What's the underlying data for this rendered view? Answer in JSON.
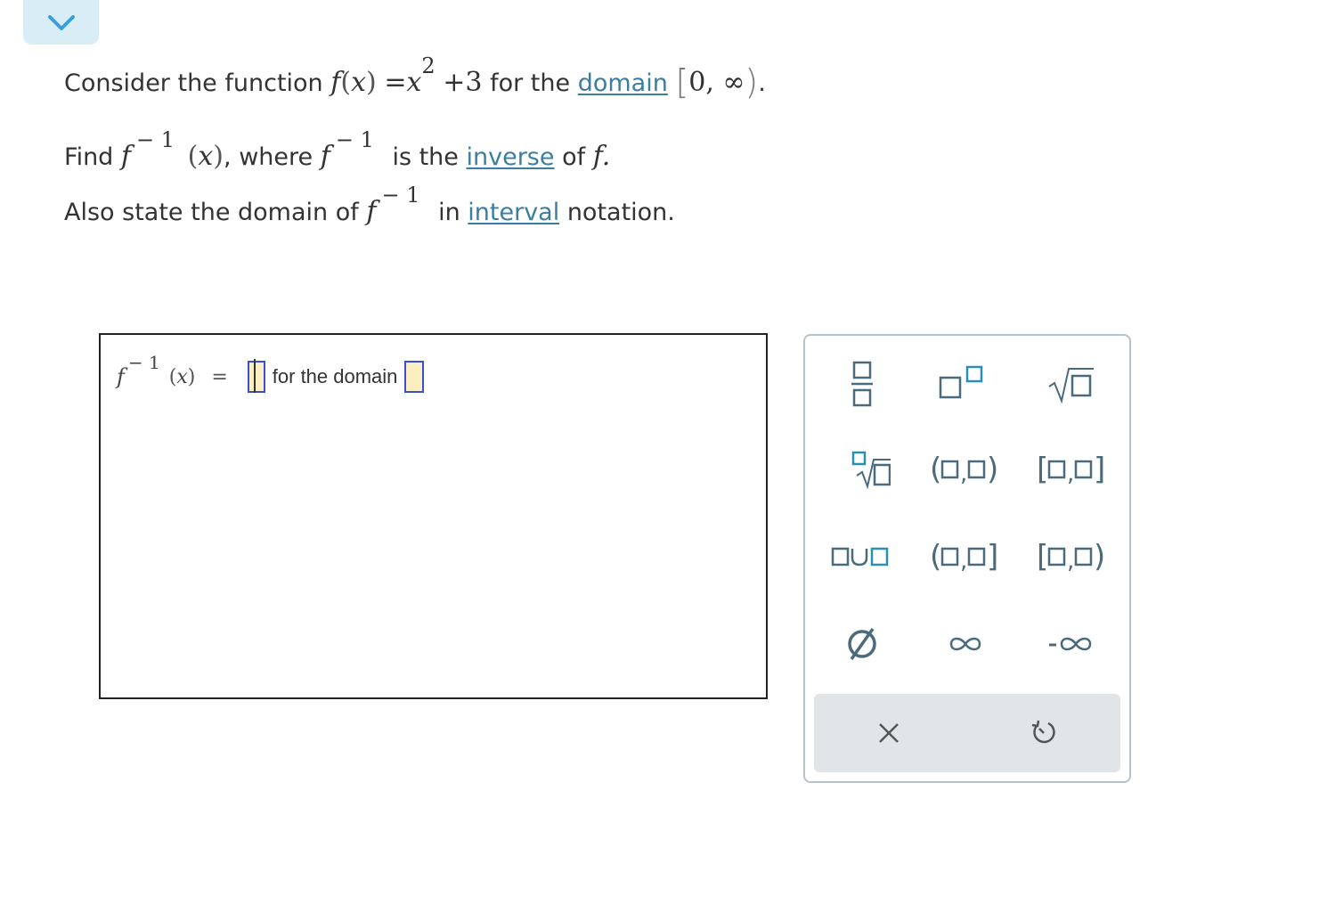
{
  "question": {
    "line1": {
      "prefix": "Consider the function",
      "fname": "f",
      "arg": "x",
      "equals": "=",
      "base": "x",
      "exponent": "2",
      "plus_term": "+3",
      "for_the": "for the",
      "link": "domain",
      "bracket_open": "[",
      "domain_value": "0, ∞",
      "bracket_close": ")",
      "period": "."
    },
    "line2": {
      "find": "Find",
      "fname": "f",
      "inv_exp": "− 1",
      "arg": "x",
      "comma": ",",
      "where": "where",
      "is_the": "is the",
      "link": "inverse",
      "of": "of",
      "end": "f."
    },
    "line3": {
      "prefix": "Also state the domain of",
      "fname": "f",
      "inv_exp": "− 1",
      "in": "in",
      "link": "interval",
      "notation": "notation."
    }
  },
  "answer": {
    "fname": "f",
    "inv_exp": "− 1",
    "arg": "x",
    "equals": "=",
    "for_domain": "for the domain"
  },
  "palette": {
    "buttons": [
      "fraction-icon",
      "superscript-icon",
      "sqrt-icon",
      "nth-root-icon",
      "open-interval-icon",
      "closed-interval-icon",
      "union-icon",
      "left-open-interval-icon",
      "right-open-interval-icon",
      "empty-set-icon",
      "infinity-icon",
      "negative-infinity-icon"
    ],
    "actions": [
      "clear-icon",
      "undo-icon"
    ]
  },
  "colors": {
    "accent": "#3a7fa3",
    "palette_icon": "#4a6b7d",
    "box_blue": "#3a4fd8",
    "box_fill": "#fdefc0"
  }
}
